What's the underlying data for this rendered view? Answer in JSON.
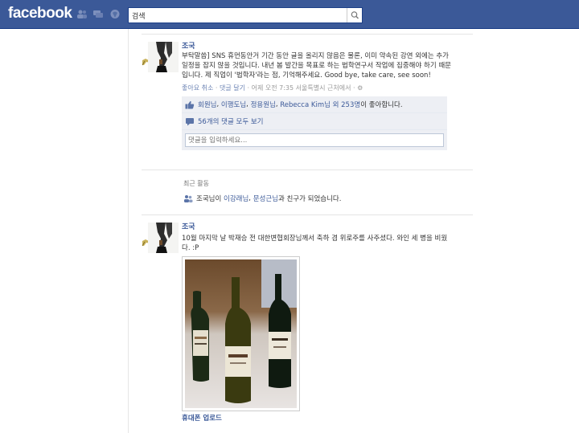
{
  "header": {
    "logo": "facebook",
    "search_value": "검색",
    "search_placeholder": "검색"
  },
  "post1": {
    "author": "조국",
    "message": "부탁말씀] SNS 휴먼동안거 기간 동안 글을 올리지 않음은 물론, 이미 약속된 강연 외에는 추가 일정을 잡지 않을 것입니다. 내년 봄 발간을 목표로 하는 법학연구서 작업에 집중해야 하기 때문입니다. 제 직업이 '법학자'라는 점, 기억해주세요. Good bye, take care, see soon!",
    "actions": {
      "unlike": "좋아요 취소",
      "comment": "댓글 달기",
      "time": "어제 오전 7:35 서울특별시 근처에서"
    },
    "likes": {
      "name1": "회원님",
      "name2": "이행도님",
      "name3": "정용원님",
      "name4": "Rebecca Kim님",
      "others": "외 253명",
      "suffix": "이 좋아합니다."
    },
    "view_comments": "56개의 댓글 모두 보기",
    "comment_placeholder": "댓글을 입력하세요..."
  },
  "recent": {
    "title": "최근 활동",
    "actor": "조국님",
    "text1": "이",
    "friend1": "이강래님",
    "sep": ",",
    "friend2": "문성근님",
    "text2": "과 친구가 되었습니다."
  },
  "post2": {
    "author": "조국",
    "message": "10월 마지막 날 박재승 전 대한변협회장님께서 축하 겸 위로주를 사주셨다. 와인 세 병을 비웠다. :P",
    "photo_caption": "휴대폰 업로드"
  },
  "colors": {
    "brand": "#3b5998",
    "feedback_bg": "#edeff4"
  },
  "icons": [
    "friends-icon",
    "messages-icon",
    "notifications-icon",
    "search-icon",
    "thumbs-up-icon",
    "comment-icon",
    "story-type-icon"
  ]
}
